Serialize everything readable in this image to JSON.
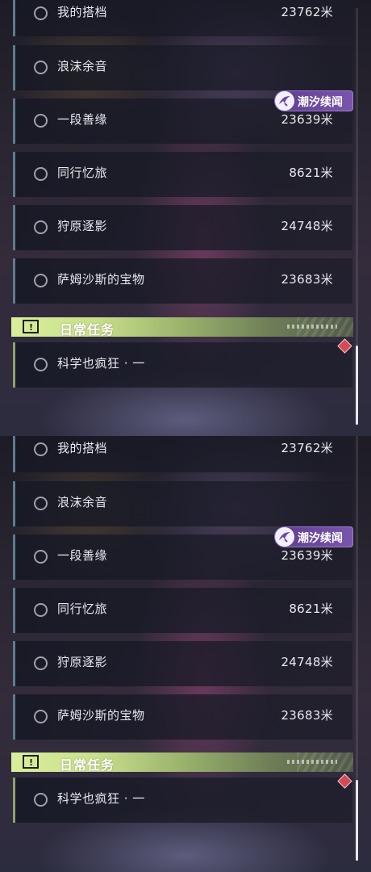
{
  "quests": [
    {
      "name": "我的搭档",
      "distance": "23762米"
    },
    {
      "name": "浪沫余音",
      "distance": ""
    },
    {
      "name": "一段善缘",
      "distance": "23639米"
    },
    {
      "name": "同行忆旅",
      "distance": "8621米"
    },
    {
      "name": "狩原逐影",
      "distance": "24748米"
    },
    {
      "name": "萨姆沙斯的宝物",
      "distance": "23683米"
    }
  ],
  "tag_label": "潮汐续闻",
  "daily": {
    "section_title": "日常任务",
    "section_icon": "!",
    "task_name": "科学也疯狂 · 一"
  },
  "colors": {
    "quest_accent": "#5c7d8c",
    "daily_accent": "#c8e08a",
    "tag_purple": "#6a48a0",
    "alert_diamond": "#d24a57"
  },
  "icons": [
    "circle-status-icon",
    "tidal-story-icon",
    "alert-box-icon",
    "diamond-marker-icon"
  ]
}
